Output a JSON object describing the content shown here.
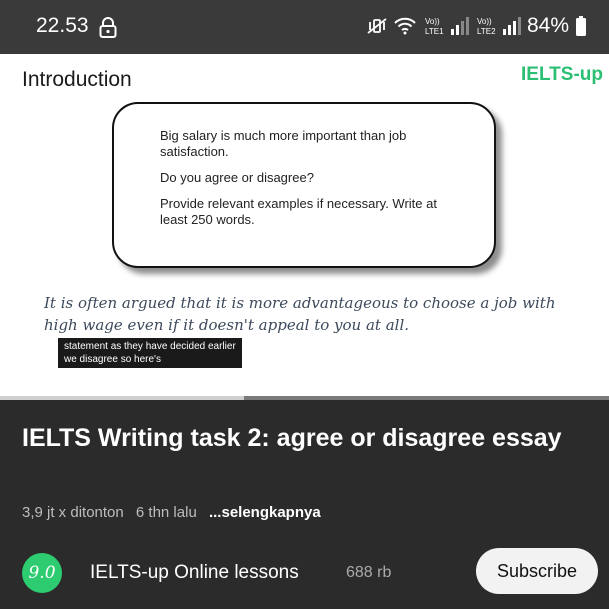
{
  "status_bar": {
    "time": "22.53",
    "battery_percent": "84%",
    "icons": [
      "lock-icon",
      "mute-vibrate-icon",
      "wifi-icon",
      "volte-lte1-signal-icon",
      "volte-lte2-signal-icon",
      "battery-icon"
    ],
    "sim1_label": "LTE1",
    "sim2_label": "LTE2",
    "volte": "Vo))"
  },
  "video": {
    "section_title": "Introduction",
    "brand": "IELTS-up",
    "card": {
      "line1": "Big salary is much more important than job satisfaction.",
      "line2": "Do you agree or disagree?",
      "line3": "Provide relevant examples if necessary. Write at least 250 words."
    },
    "handwriting": "It is often argued that it is more advantageous to choose a job with high wage even if it doesn't appeal to you at all.",
    "captions": [
      "statement as they have decided earlier",
      "we disagree so here's"
    ],
    "progress_fraction": 0.4,
    "colors": {
      "brand": "#2bbf73",
      "panel_bg": "#2b2b2b"
    }
  },
  "info": {
    "title": "IELTS Writing task 2: agree or disagree essay",
    "views": "3,9 jt x ditonton",
    "age": "6 thn lalu",
    "more": "...selengkapnya",
    "channel": {
      "avatar_text": "9.0",
      "name": "IELTS-up Online lessons",
      "subscribers": "688 rb"
    },
    "subscribe_label": "Subscribe"
  }
}
